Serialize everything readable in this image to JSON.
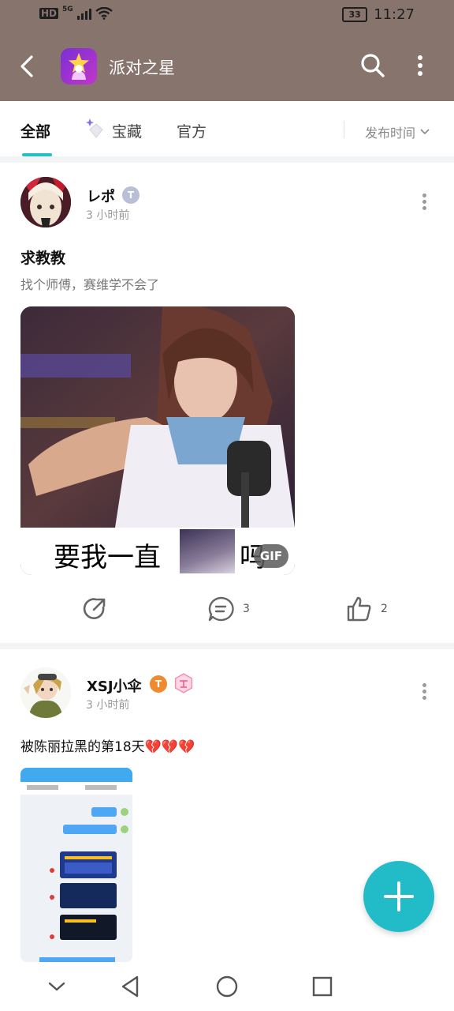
{
  "status_bar": {
    "network": "HD",
    "signal_gen": "5G",
    "battery": "33",
    "time": "11:27"
  },
  "app_bar": {
    "title": "派对之星",
    "icons": [
      "back-arrow-icon",
      "app-logo-icon",
      "search-icon",
      "more-vertical-icon"
    ]
  },
  "tabs": {
    "items": [
      {
        "label": "全部",
        "active": true
      },
      {
        "label": "宝藏",
        "active": false
      },
      {
        "label": "官方",
        "active": false
      }
    ],
    "sort_label": "发布时间"
  },
  "posts": [
    {
      "username": "レポ",
      "badge": "T",
      "time": "3 小时前",
      "title": "求教教",
      "body": "找个师傅，赛维学不会了",
      "image": {
        "type": "gif",
        "caption_left": "要我一直",
        "caption_right": "吗",
        "badge": "GIF"
      },
      "actions": {
        "share": "",
        "comments": "3",
        "likes": "2"
      }
    },
    {
      "username": "XSJ小伞",
      "badge": "T",
      "time": "3 小时前",
      "text": "被陈丽拉黑的第18天💔💔💔",
      "image": {
        "type": "screenshot"
      }
    }
  ],
  "fab": {
    "icon": "plus-icon"
  },
  "nav_bar": {
    "icons": [
      "chevron-down-icon",
      "back-triangle-icon",
      "home-circle-icon",
      "recents-square-icon"
    ]
  },
  "colors": {
    "app_bar_bg": "#86746d",
    "accent": "#21c1c7",
    "fab_bg": "#21bcc8",
    "badge_orange": "#f08a2e"
  }
}
